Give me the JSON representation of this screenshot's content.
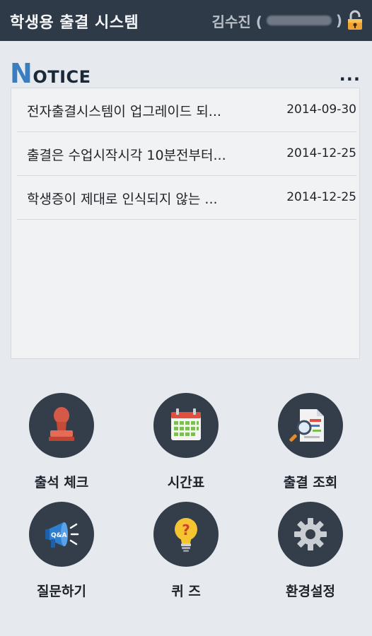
{
  "header": {
    "title": "학생용 출결 시스템",
    "user_name": "김수진 (",
    "user_id_close": ")"
  },
  "notice": {
    "title_cap": "N",
    "title_rest": "OTICE",
    "more_label": "...",
    "items": [
      {
        "title": "전자출결시스템이 업그레이드 되...",
        "date": "2014-09-30"
      },
      {
        "title": "출결은 수업시작시각 10분전부터...",
        "date": "2014-12-25"
      },
      {
        "title": "학생증이 제대로 인식되지 않는 ...",
        "date": "2014-12-25"
      }
    ]
  },
  "menu": [
    {
      "label": "출석 체크",
      "icon": "stamp-icon"
    },
    {
      "label": "시간표",
      "icon": "calendar-icon"
    },
    {
      "label": "출결 조회",
      "icon": "document-search-icon"
    },
    {
      "label": "질문하기",
      "icon": "megaphone-qa-icon"
    },
    {
      "label": "퀴 즈",
      "icon": "lightbulb-question-icon"
    },
    {
      "label": "환경설정",
      "icon": "gear-icon"
    }
  ],
  "colors": {
    "header_bg": "#2f3a48",
    "accent_blue": "#3b7ebf",
    "circle_bg": "#343d4a",
    "page_bg": "#e6eaee"
  }
}
